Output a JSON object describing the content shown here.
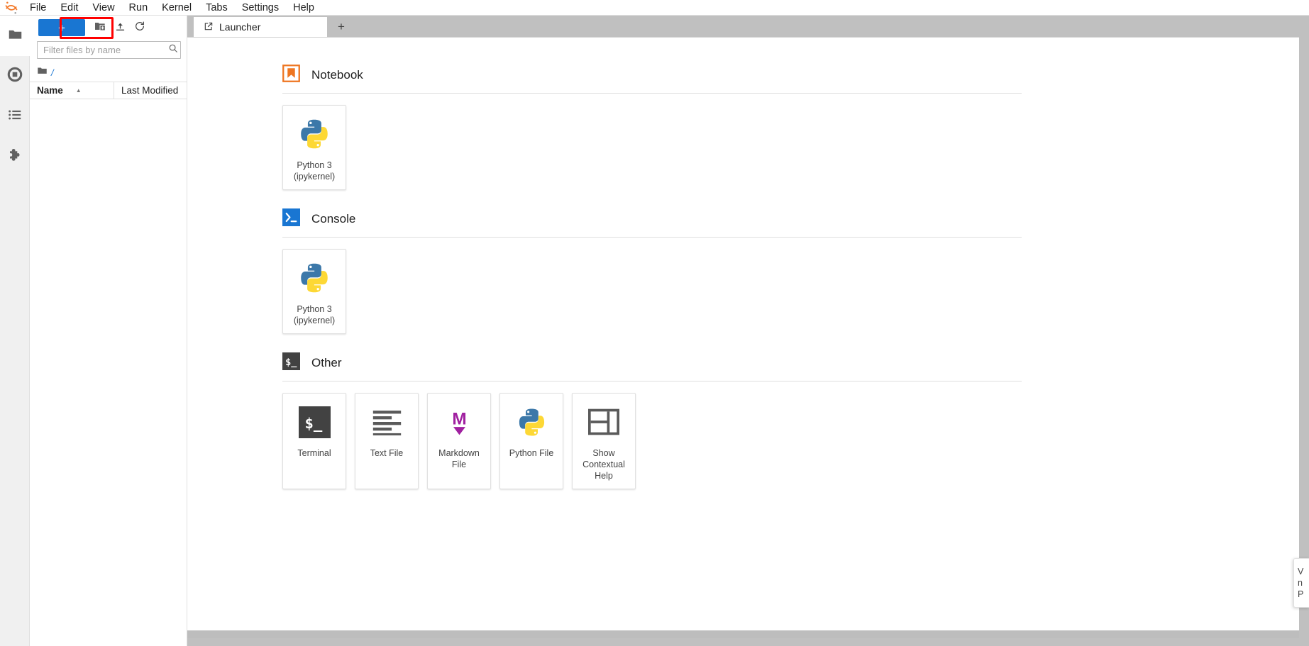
{
  "app": {
    "logo_icon": "jupyter-logo",
    "menus": [
      "File",
      "Edit",
      "View",
      "Run",
      "Kernel",
      "Tabs",
      "Settings",
      "Help"
    ]
  },
  "activity_bar": {
    "items": [
      {
        "icon": "folder-icon",
        "name": "file-browser",
        "active": true
      },
      {
        "icon": "running-sessions-icon",
        "name": "running-terminals-kernels",
        "active": false
      },
      {
        "icon": "command-palette-icon",
        "name": "commands",
        "active": false
      },
      {
        "icon": "puzzle-piece-icon",
        "name": "extension-manager",
        "active": false
      }
    ]
  },
  "file_browser": {
    "toolbar": {
      "new_launcher_label": "+",
      "new_folder_icon": "new-folder-icon",
      "upload_icon": "upload-icon",
      "refresh_icon": "refresh-icon"
    },
    "filter": {
      "placeholder": "Filter files by name",
      "value": "",
      "icon": "search-icon"
    },
    "breadcrumb": {
      "home_icon": "folder-icon",
      "path": "/"
    },
    "columns": {
      "name": "Name",
      "last_modified": "Last Modified",
      "sort_indicator": "▲"
    },
    "rows": []
  },
  "dock": {
    "tabs": [
      {
        "label": "Launcher",
        "icon": "launcher-icon",
        "active": true
      }
    ],
    "add_tab_label": "+"
  },
  "launcher": {
    "sections": [
      {
        "title": "Notebook",
        "icon": "notebook-bookmark-icon",
        "icon_color": "#ee7622",
        "cards": [
          {
            "label": "Python 3\n(ipykernel)",
            "icon": "python-logo-icon"
          }
        ]
      },
      {
        "title": "Console",
        "icon": "console-prompt-icon",
        "icon_color": "#1976d2",
        "cards": [
          {
            "label": "Python 3\n(ipykernel)",
            "icon": "python-logo-icon"
          }
        ]
      },
      {
        "title": "Other",
        "icon": "terminal-dollar-icon",
        "icon_color": "#424242",
        "cards": [
          {
            "label": "Terminal",
            "icon": "terminal-dollar-icon"
          },
          {
            "label": "Text File",
            "icon": "text-lines-icon"
          },
          {
            "label": "Markdown File",
            "icon": "markdown-m-icon"
          },
          {
            "label": "Python File",
            "icon": "python-logo-icon"
          },
          {
            "label": "Show\nContextual\nHelp",
            "icon": "contextual-help-icon"
          }
        ]
      }
    ]
  },
  "notification": {
    "line1": "V",
    "line2": "n",
    "line3": "P"
  },
  "annotation": {
    "highlight_color": "#ff0000",
    "target": "new-launcher-button"
  },
  "colors": {
    "accent_blue": "#1976d2",
    "notebook_orange": "#ee7622",
    "markdown_purple": "#a020a0",
    "dark_gray": "#424242",
    "chrome_gray": "#c0c0c0"
  }
}
